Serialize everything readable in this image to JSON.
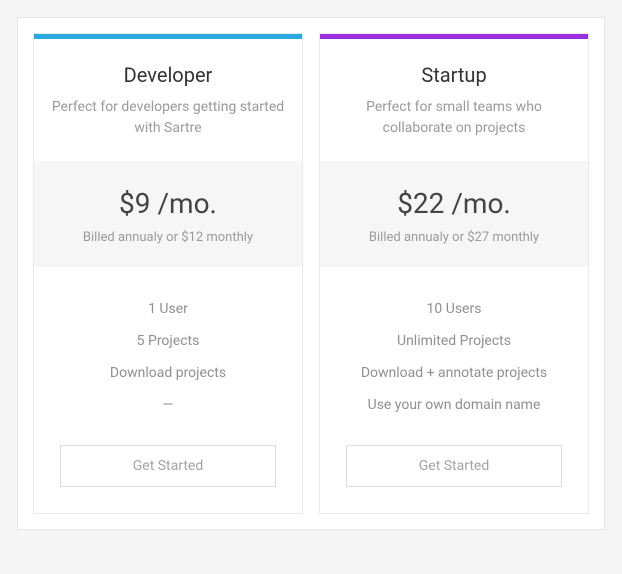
{
  "plans": [
    {
      "accent": "#2aa9e0",
      "title": "Developer",
      "subtitle": "Perfect for developers getting started with Sartre",
      "price": "$9 /mo.",
      "billing": "Billed annualy or $12 monthly",
      "features": [
        "1 User",
        "5 Projects",
        "Download projects",
        "—"
      ],
      "cta": "Get Started"
    },
    {
      "accent": "#9b2fe0",
      "title": "Startup",
      "subtitle": "Perfect for small teams who collaborate on projects",
      "price": "$22 /mo.",
      "billing": "Billed annualy or $27 monthly",
      "features": [
        "10 Users",
        "Unlimited Projects",
        "Download + annotate projects",
        "Use your own domain name"
      ],
      "cta": "Get Started"
    }
  ]
}
